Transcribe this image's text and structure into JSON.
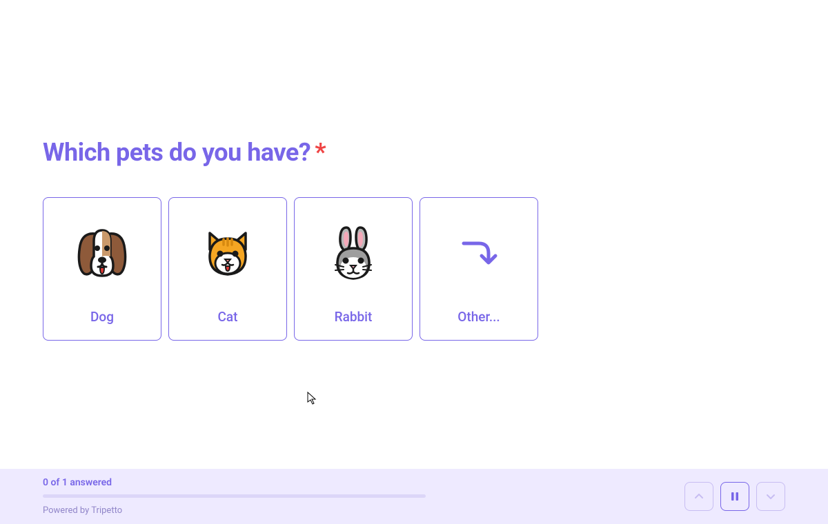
{
  "question": {
    "title": "Which pets do you have?",
    "required_marker": "*"
  },
  "options": [
    {
      "label": "Dog",
      "icon": "dog"
    },
    {
      "label": "Cat",
      "icon": "cat"
    },
    {
      "label": "Rabbit",
      "icon": "rabbit"
    },
    {
      "label": "Other...",
      "icon": "other-arrow"
    }
  ],
  "footer": {
    "progress_text": "0 of 1 answered",
    "powered_by": "Powered by Tripetto"
  },
  "colors": {
    "accent": "#7866e8",
    "required": "#ef4444",
    "footer_bg": "#eeeaff"
  }
}
